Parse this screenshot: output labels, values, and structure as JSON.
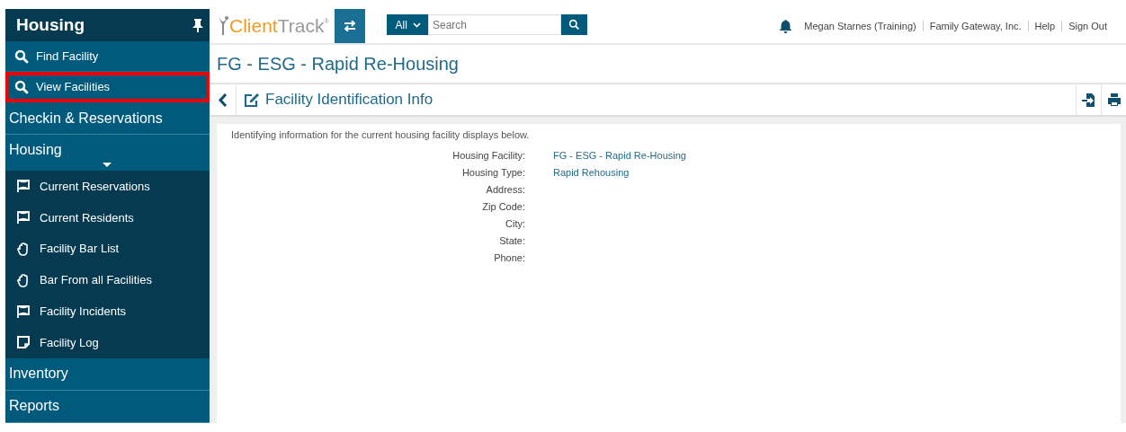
{
  "sidebar": {
    "title": "Housing",
    "pinned": true,
    "items": [
      {
        "label": "Find Facility",
        "kind": "search",
        "highlighted": false
      },
      {
        "label": "View Facilities",
        "kind": "search",
        "highlighted": true
      }
    ],
    "sections": [
      {
        "label": "Checkin & Reservations",
        "expanded": false
      },
      {
        "label": "Housing",
        "expanded": true,
        "children": [
          {
            "label": "Current Reservations",
            "kind": "flag"
          },
          {
            "label": "Current Residents",
            "kind": "flag"
          },
          {
            "label": "Facility Bar List",
            "kind": "hand"
          },
          {
            "label": "Bar From all Facilities",
            "kind": "hand"
          },
          {
            "label": "Facility Incidents",
            "kind": "flag"
          },
          {
            "label": "Facility Log",
            "kind": "note"
          }
        ]
      },
      {
        "label": "Inventory",
        "expanded": false
      },
      {
        "label": "Reports",
        "expanded": false
      }
    ]
  },
  "topbar": {
    "logo_primary": "Client",
    "logo_secondary": "Track",
    "logo_mark": "®",
    "search": {
      "scope": "All",
      "placeholder": "Search"
    },
    "links": [
      "Megan Starnes (Training)",
      "Family Gateway, Inc.",
      "Help",
      "Sign Out"
    ]
  },
  "page": {
    "title": "FG - ESG - Rapid Re-Housing",
    "section_title": "Facility Identification Info",
    "description": "Identifying information for the current housing facility displays below.",
    "fields": [
      {
        "label": "Housing Facility:",
        "value": "FG - ESG - Rapid Re-Housing"
      },
      {
        "label": "Housing Type:",
        "value": "Rapid Rehousing"
      },
      {
        "label": "Address:"
      },
      {
        "label": "Zip Code:"
      },
      {
        "label": "City:"
      },
      {
        "label": "State:"
      },
      {
        "label": "Phone:"
      }
    ]
  }
}
